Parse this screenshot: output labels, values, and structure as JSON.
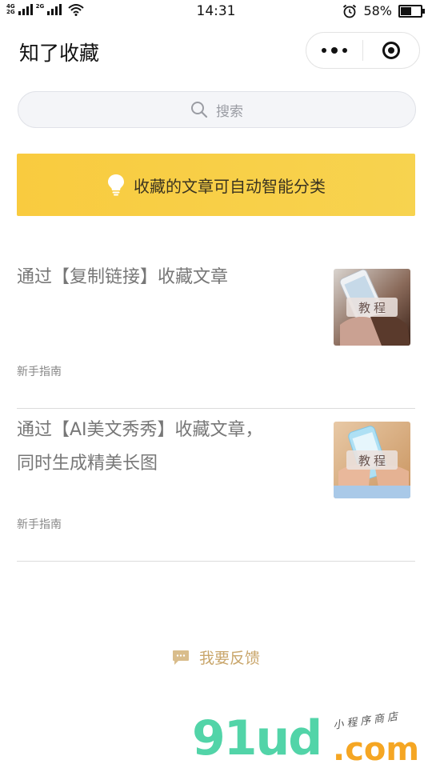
{
  "status_bar": {
    "network_top": "4G",
    "network_bottom": "2G",
    "network_mid": "2G",
    "time": "14:31",
    "battery_percent": "58%",
    "battery_level": 0.58
  },
  "nav": {
    "title": "知了收藏"
  },
  "search": {
    "placeholder": "搜索"
  },
  "banner": {
    "text": "收藏的文章可自动智能分类",
    "color": "#f9cb3f"
  },
  "articles": [
    {
      "title_lines": [
        "通过【复制链接】收藏文章"
      ],
      "category": "新手指南",
      "thumb_badge": "教程"
    },
    {
      "title_lines": [
        "通过【AI美文秀秀】收藏文章，",
        "同时生成精美长图"
      ],
      "category": "新手指南",
      "thumb_badge": "教程"
    }
  ],
  "feedback": {
    "label": "我要反馈",
    "color": "#c9a66b"
  },
  "watermark": {
    "brand": "91ud",
    "domain": ".com",
    "tagline": "小程序商店"
  }
}
